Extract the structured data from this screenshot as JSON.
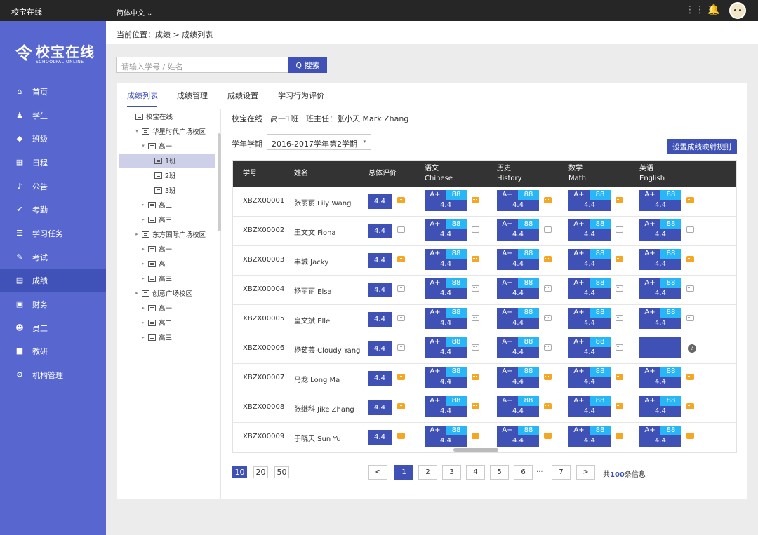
{
  "topbar": {
    "brand": "校宝在线",
    "language": "简体中文 ⌄",
    "grid_icon": "⋮⋮⋮",
    "bell_icon": "🔔"
  },
  "logo": {
    "mark": "令",
    "cn": "校宝在线",
    "en": "SCHOOLPAL ONLINE"
  },
  "nav": [
    {
      "label": "首页",
      "icon": "home-icon",
      "glyph": "⌂"
    },
    {
      "label": "学生",
      "icon": "student-icon",
      "glyph": "♟"
    },
    {
      "label": "班级",
      "icon": "graduation-cap-icon",
      "glyph": "◆"
    },
    {
      "label": "日程",
      "icon": "calendar-icon",
      "glyph": "▦"
    },
    {
      "label": "公告",
      "icon": "bell-icon",
      "glyph": "♪"
    },
    {
      "label": "考勤",
      "icon": "clipboard-check-icon",
      "glyph": "✔"
    },
    {
      "label": "学习任务",
      "icon": "task-list-icon",
      "glyph": "☰"
    },
    {
      "label": "考试",
      "icon": "exam-edit-icon",
      "glyph": "✎"
    },
    {
      "label": "成绩",
      "icon": "grade-doc-icon",
      "glyph": "▤",
      "active": true
    },
    {
      "label": "财务",
      "icon": "wallet-icon",
      "glyph": "▣"
    },
    {
      "label": "员工",
      "icon": "staff-icon",
      "glyph": "☻"
    },
    {
      "label": "教研",
      "icon": "book-icon",
      "glyph": "■"
    },
    {
      "label": "机构管理",
      "icon": "org-settings-icon",
      "glyph": "⚙"
    }
  ],
  "breadcrumb": "当前位置：成绩 > 成绩列表",
  "search": {
    "placeholder": "请输入学号 / 姓名",
    "button": "Q 搜索"
  },
  "tabs": [
    "成绩列表",
    "成绩管理",
    "成绩设置",
    "学习行为评价"
  ],
  "tree": [
    {
      "label": "校宝在线",
      "depth": 0,
      "arrow": ""
    },
    {
      "label": "华星时代广场校区",
      "depth": 1,
      "arrow": "▾"
    },
    {
      "label": "高一",
      "depth": 2,
      "arrow": "▾"
    },
    {
      "label": "1班",
      "depth": 3,
      "arrow": "",
      "selected": true
    },
    {
      "label": "2班",
      "depth": 3,
      "arrow": ""
    },
    {
      "label": "3班",
      "depth": 3,
      "arrow": ""
    },
    {
      "label": "高二",
      "depth": 2,
      "arrow": "▸"
    },
    {
      "label": "高三",
      "depth": 2,
      "arrow": "▸"
    },
    {
      "label": "东方国际广场校区",
      "depth": 1,
      "arrow": "▸"
    },
    {
      "label": "高一",
      "depth": 2,
      "arrow": "▸"
    },
    {
      "label": "高二",
      "depth": 2,
      "arrow": "▸"
    },
    {
      "label": "高三",
      "depth": 2,
      "arrow": "▸"
    },
    {
      "label": "创意广场校区",
      "depth": 1,
      "arrow": "▸"
    },
    {
      "label": "高一",
      "depth": 2,
      "arrow": "▸"
    },
    {
      "label": "高二",
      "depth": 2,
      "arrow": "▸"
    },
    {
      "label": "高三",
      "depth": 2,
      "arrow": "▸"
    }
  ],
  "classinfo": "校宝在线　高一1班　班主任：张小天 Mark Zhang",
  "term": {
    "label": "学年学期",
    "value": "2016-2017学年第2学期",
    "caret": "▾"
  },
  "map_button": "设置成绩映射规则",
  "table": {
    "headers": {
      "id": "学号",
      "name": "姓名",
      "overall": "总体评价"
    },
    "subjects": [
      {
        "cn": "语文",
        "en": "Chinese"
      },
      {
        "cn": "历史",
        "en": "History"
      },
      {
        "cn": "数学",
        "en": "Math"
      },
      {
        "cn": "英语",
        "en": "English"
      }
    ],
    "rows": [
      {
        "id": "XBZX00001",
        "name": "张丽丽 Lily Wang",
        "overall": "4.4",
        "oc": true,
        "scores": [
          {
            "g": "A+",
            "s": "88",
            "p": "4.4",
            "c": true
          },
          {
            "g": "A+",
            "s": "88",
            "p": "4.4",
            "c": true
          },
          {
            "g": "A+",
            "s": "88",
            "p": "4.4",
            "c": true
          },
          {
            "g": "A+",
            "s": "88",
            "p": "4.4",
            "c": true
          }
        ]
      },
      {
        "id": "XBZX00002",
        "name": "王文文 Fiona",
        "overall": "4.4",
        "oc": false,
        "scores": [
          {
            "g": "A+",
            "s": "88",
            "p": "4.4",
            "c": false
          },
          {
            "g": "A+",
            "s": "88",
            "p": "4.4",
            "c": false
          },
          {
            "g": "A+",
            "s": "88",
            "p": "4.4",
            "c": false
          },
          {
            "g": "A+",
            "s": "88",
            "p": "4.4",
            "c": false
          }
        ]
      },
      {
        "id": "XBZX00003",
        "name": "丰城 Jacky",
        "overall": "4.4",
        "oc": true,
        "scores": [
          {
            "g": "A+",
            "s": "88",
            "p": "4.4",
            "c": true
          },
          {
            "g": "A+",
            "s": "88",
            "p": "4.4",
            "c": true
          },
          {
            "g": "A+",
            "s": "88",
            "p": "4.4",
            "c": true
          },
          {
            "g": "A+",
            "s": "88",
            "p": "4.4",
            "c": true
          }
        ]
      },
      {
        "id": "XBZX00004",
        "name": "杨丽丽 Elsa",
        "overall": "4.4",
        "oc": false,
        "scores": [
          {
            "g": "A+",
            "s": "88",
            "p": "4.4",
            "c": false
          },
          {
            "g": "A+",
            "s": "88",
            "p": "4.4",
            "c": false
          },
          {
            "g": "A+",
            "s": "88",
            "p": "4.4",
            "c": false
          },
          {
            "g": "A+",
            "s": "88",
            "p": "4.4",
            "c": false
          }
        ]
      },
      {
        "id": "XBZX00005",
        "name": "皇文斌 Elle",
        "overall": "4.4",
        "oc": false,
        "scores": [
          {
            "g": "A+",
            "s": "88",
            "p": "4.4",
            "c": false
          },
          {
            "g": "A+",
            "s": "88",
            "p": "4.4",
            "c": false
          },
          {
            "g": "A+",
            "s": "88",
            "p": "4.4",
            "c": false
          },
          {
            "g": "A+",
            "s": "88",
            "p": "4.4",
            "c": false
          }
        ]
      },
      {
        "id": "XBZX00006",
        "name": "杨茹芸 Cloudy Yang",
        "overall": "4.4",
        "oc": false,
        "scores": [
          {
            "g": "A+",
            "s": "88",
            "p": "4.4",
            "c": false
          },
          {
            "g": "A+",
            "s": "88",
            "p": "4.4",
            "c": false
          },
          {
            "g": "A+",
            "s": "88",
            "p": "4.4",
            "c": false
          },
          {
            "empty": true,
            "dash": "–",
            "help": "?"
          }
        ]
      },
      {
        "id": "XBZX00007",
        "name": "马龙 Long Ma",
        "overall": "4.4",
        "oc": true,
        "scores": [
          {
            "g": "A+",
            "s": "88",
            "p": "4.4",
            "c": true
          },
          {
            "g": "A+",
            "s": "88",
            "p": "4.4",
            "c": true
          },
          {
            "g": "A+",
            "s": "88",
            "p": "4.4",
            "c": true
          },
          {
            "g": "A+",
            "s": "88",
            "p": "4.4",
            "c": true
          }
        ]
      },
      {
        "id": "XBZX00008",
        "name": "张继科 Jike Zhang",
        "overall": "4.4",
        "oc": true,
        "scores": [
          {
            "g": "A+",
            "s": "88",
            "p": "4.4",
            "c": true
          },
          {
            "g": "A+",
            "s": "88",
            "p": "4.4",
            "c": true
          },
          {
            "g": "A+",
            "s": "88",
            "p": "4.4",
            "c": true
          },
          {
            "g": "A+",
            "s": "88",
            "p": "4.4",
            "c": true
          }
        ]
      },
      {
        "id": "XBZX00009",
        "name": "于晓天 Sun Yu",
        "overall": "4.4",
        "oc": true,
        "scores": [
          {
            "g": "A+",
            "s": "88",
            "p": "4.4",
            "c": true
          },
          {
            "g": "A+",
            "s": "88",
            "p": "4.4",
            "c": true
          },
          {
            "g": "A+",
            "s": "88",
            "p": "4.4",
            "c": true
          },
          {
            "g": "A+",
            "s": "88",
            "p": "4.4",
            "c": true
          }
        ]
      }
    ]
  },
  "pagination": {
    "sizes": [
      {
        "label": "10",
        "active": true
      },
      {
        "label": "20"
      },
      {
        "label": "50"
      }
    ],
    "prev": "<",
    "pages": [
      {
        "label": "1",
        "active": true
      },
      {
        "label": "2"
      },
      {
        "label": "3"
      },
      {
        "label": "4"
      },
      {
        "label": "5"
      },
      {
        "label": "6"
      },
      {
        "label": "7"
      }
    ],
    "dots": "···",
    "next": ">",
    "total_prefix": "共",
    "total_count": "100",
    "total_suffix": "条信息"
  },
  "colors": {
    "primary": "#3f51b5",
    "sidebar": "#5767cf",
    "score_badge": "#29b6f6",
    "comment_active": "#f5a623",
    "header_dark": "#333333"
  }
}
